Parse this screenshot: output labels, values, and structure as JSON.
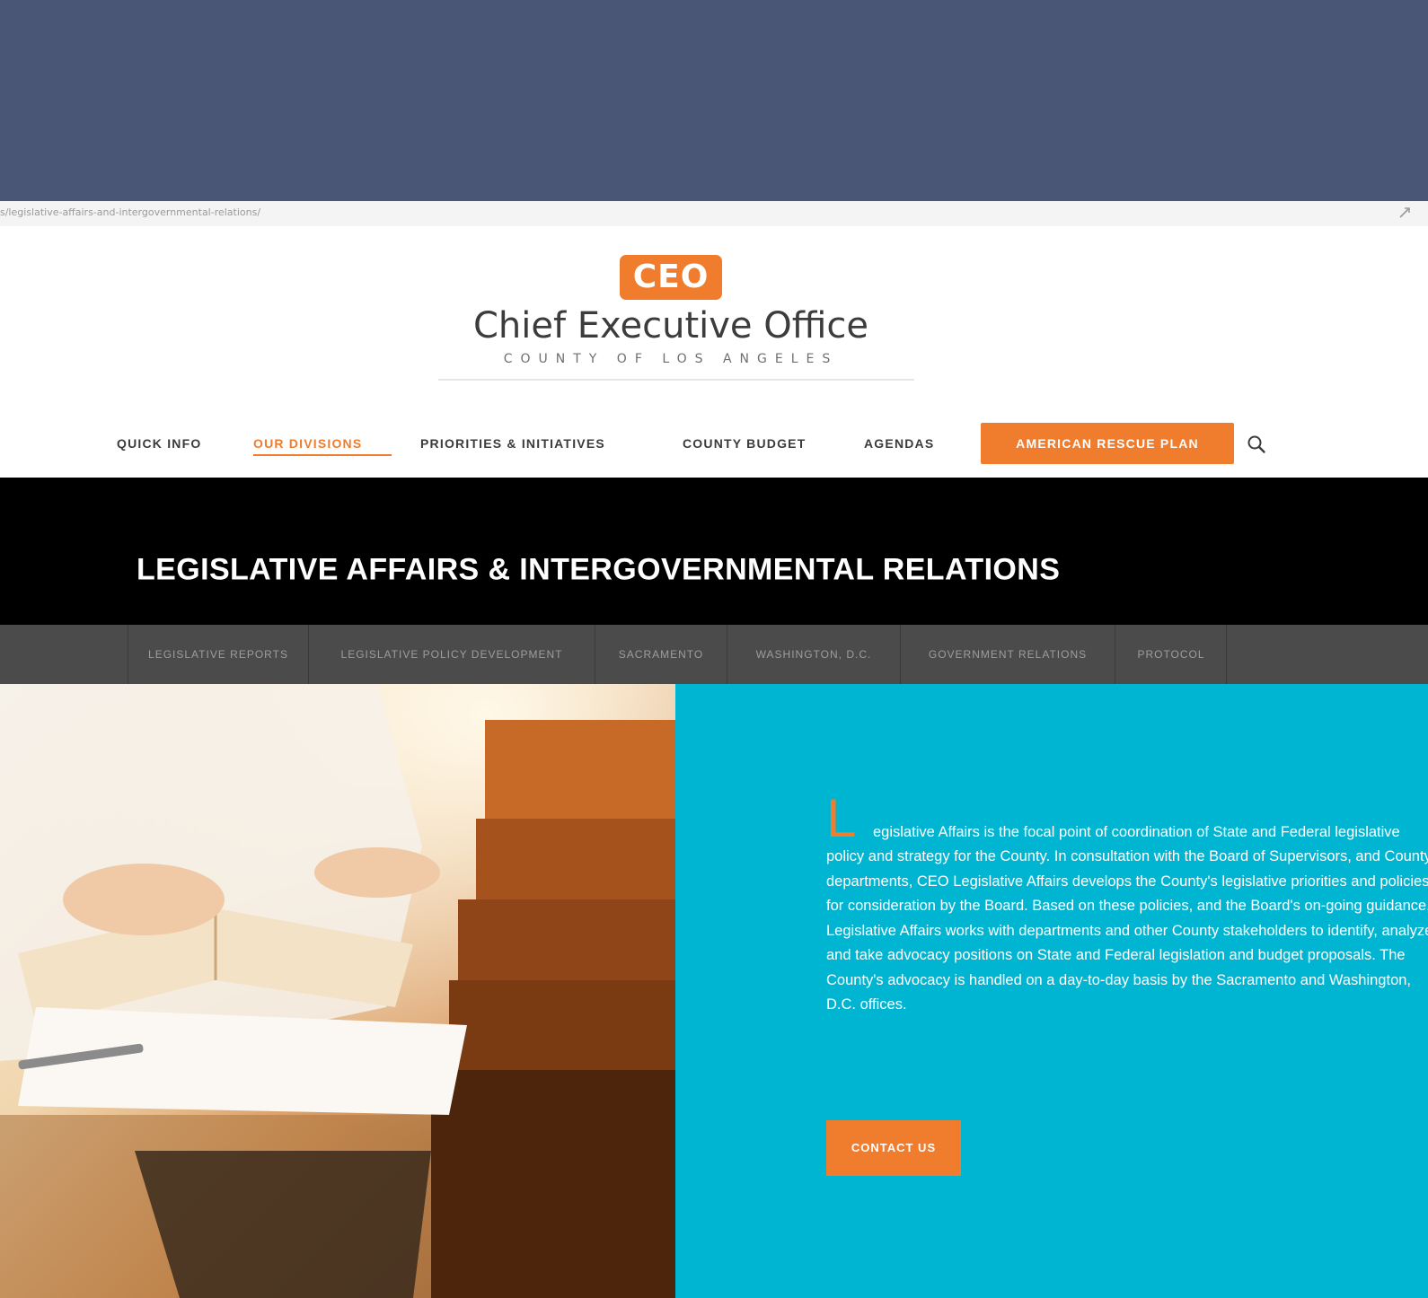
{
  "browser": {
    "url": "s/legislative-affairs-and-intergovernmental-relations/"
  },
  "header": {
    "logo_badge": "CEO",
    "logo_title": "Chief Executive Office",
    "logo_subtitle": "COUNTY OF LOS ANGELES"
  },
  "nav": {
    "items": [
      {
        "label": "QUICK INFO"
      },
      {
        "label": "OUR DIVISIONS"
      },
      {
        "label": "PRIORITIES & INITIATIVES"
      },
      {
        "label": "COUNTY BUDGET"
      },
      {
        "label": "AGENDAS"
      }
    ],
    "active_item": "OUR DIVISIONS",
    "cta_label": "AMERICAN RESCUE PLAN",
    "search_icon": "search-icon"
  },
  "page": {
    "title": "LEGISLATIVE AFFAIRS & INTERGOVERNMENTAL RELATIONS"
  },
  "subnav": {
    "items": [
      {
        "label": "LEGISLATIVE REPORTS"
      },
      {
        "label": "LEGISLATIVE POLICY DEVELOPMENT"
      },
      {
        "label": "SACRAMENTO"
      },
      {
        "label": "WASHINGTON, D.C."
      },
      {
        "label": "GOVERNMENT RELATIONS"
      },
      {
        "label": "PROTOCOL"
      }
    ]
  },
  "intro": {
    "dropcap": "L",
    "text": "egislative Affairs is the focal point of coordination of State and Federal legislative policy and strategy for the County. In consultation with the Board of Supervisors, and County departments, CEO Legislative Affairs develops the County's legislative priorities and policies for consideration by the Board. Based on these policies, and the Board's on-going guidance, Legislative Affairs works with departments and other County stakeholders to identify, analyze, and take advocacy positions on State and Federal legislation and budget proposals. The County's advocacy is handled on a day-to-day basis by the Sacramento and Washington, D.C. offices.",
    "contact_label": "CONTACT US"
  },
  "colors": {
    "top_band": "#4a5676",
    "brand_orange": "#ef7d2d",
    "title_band": "#000000",
    "subnav_bg": "#4b4b4b",
    "info_panel": "#00b5d2"
  }
}
